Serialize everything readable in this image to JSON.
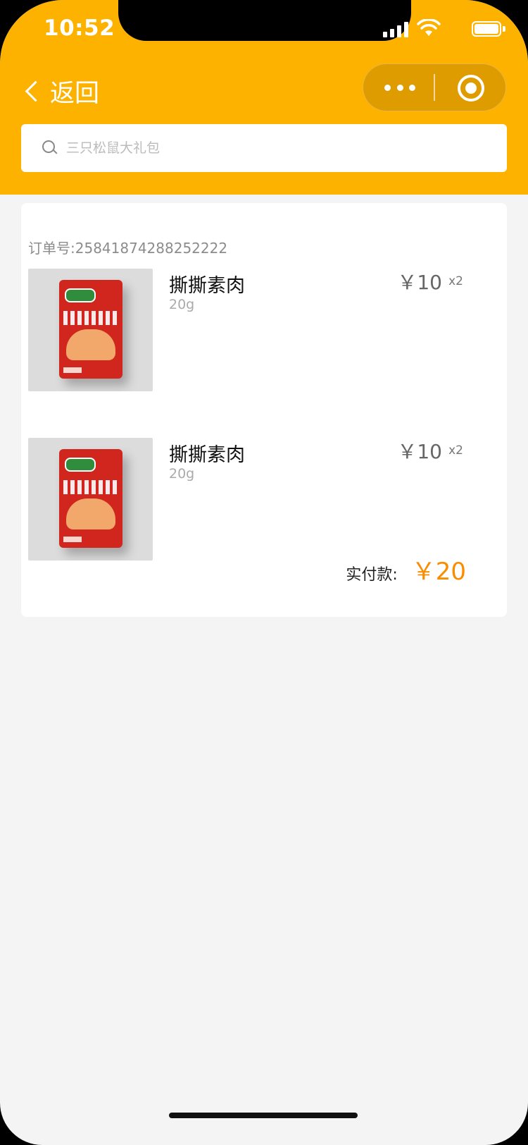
{
  "status_bar": {
    "time": "10:52"
  },
  "nav": {
    "back_label": "返回"
  },
  "search": {
    "placeholder": "三只松鼠大礼包"
  },
  "order": {
    "order_no_label": "订单号:",
    "order_no": "25841874288252222",
    "items": [
      {
        "name": "撕撕素肉",
        "spec": "20g",
        "price": "￥10",
        "qty": "x2"
      },
      {
        "name": "撕撕素肉",
        "spec": "20g",
        "price": "￥10",
        "qty": "x2"
      }
    ],
    "paid_label": "实付款:",
    "paid_amount": "￥20"
  },
  "colors": {
    "header": "#fdb200",
    "accent_price": "#fb8c00",
    "background": "#f4f4f4"
  }
}
